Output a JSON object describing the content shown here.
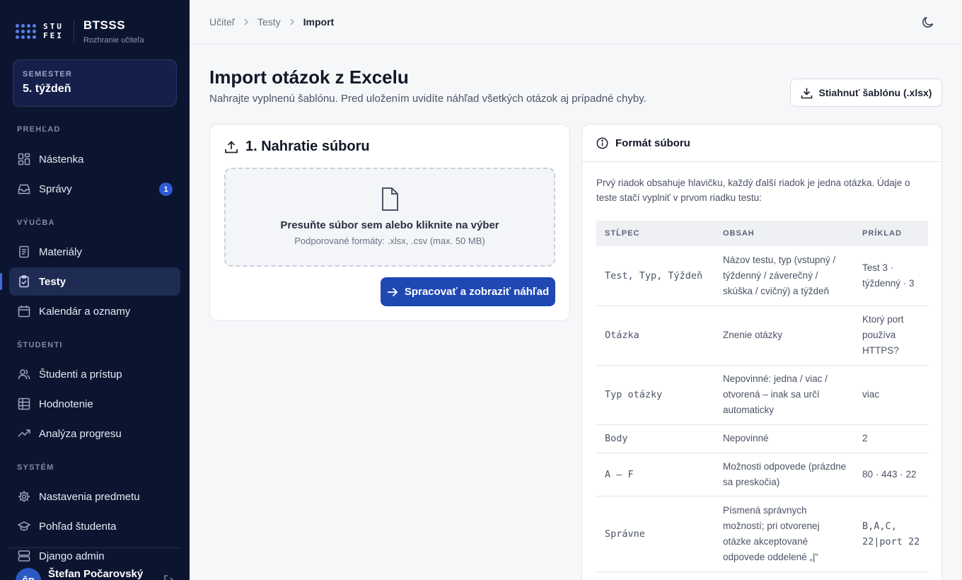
{
  "brand": {
    "logo_text_1": "STU",
    "logo_text_2": "FEI",
    "name": "BTSSS",
    "subtitle": "Rozhranie učiteľa"
  },
  "semester": {
    "label": "SEMESTER",
    "value": "5. týždeň"
  },
  "sidebar": {
    "sections": [
      {
        "label": "PREHĽAD",
        "items": [
          {
            "label": "Nástenka",
            "icon": "dashboard-icon"
          },
          {
            "label": "Správy",
            "icon": "inbox-icon",
            "badge": "1"
          }
        ]
      },
      {
        "label": "VÝUČBA",
        "items": [
          {
            "label": "Materiály",
            "icon": "document-icon"
          },
          {
            "label": "Testy",
            "icon": "clipboard-check-icon",
            "active": true
          },
          {
            "label": "Kalendár a oznamy",
            "icon": "calendar-icon"
          }
        ]
      },
      {
        "label": "ŠTUDENTI",
        "items": [
          {
            "label": "Študenti a prístup",
            "icon": "users-icon"
          },
          {
            "label": "Hodnotenie",
            "icon": "table-icon"
          },
          {
            "label": "Analýza progresu",
            "icon": "trend-icon"
          }
        ]
      },
      {
        "label": "SYSTÉM",
        "items": [
          {
            "label": "Nastavenia predmetu",
            "icon": "gear-icon"
          },
          {
            "label": "Pohľad študenta",
            "icon": "graduation-cap-icon"
          },
          {
            "label": "Django admin",
            "icon": "server-icon"
          }
        ]
      }
    ]
  },
  "user": {
    "initials": "ŠP",
    "name": "Štefan Počarovský"
  },
  "breadcrumb": [
    "Učiteľ",
    "Testy",
    "Import"
  ],
  "page": {
    "title": "Import otázok z Excelu",
    "subtitle": "Nahrajte vyplnenú šablónu. Pred uložením uvidíte náhľad všetkých otázok aj prípadné chyby.",
    "download_label": "Stiahnuť šablónu (.xlsx)"
  },
  "upload": {
    "title": "1. Nahratie súboru",
    "drop_text": "Presuňte súbor sem alebo kliknite na výber",
    "formats": "Podporované formáty: .xlsx, .csv (max. 50 MB)",
    "process_label": "Spracovať a zobraziť náhľad"
  },
  "format": {
    "title": "Formát súboru",
    "intro": "Prvý riadok obsahuje hlavičku, každý ďalší riadok je jedna otázka. Údaje o teste stačí vyplniť v prvom riadku testu:",
    "headers": [
      "STĹPEC",
      "OBSAH",
      "PRÍKLAD"
    ],
    "rows": [
      {
        "col": "Test, Typ, Týždeň",
        "content": "Názov testu, typ (vstupný / týždenný / záverečný / skúška / cvičný) a týždeň",
        "example": "Test 3 · týždenný · 3"
      },
      {
        "col": "Otázka",
        "content": "Znenie otázky",
        "example": "Ktorý port používa HTTPS?"
      },
      {
        "col": "Typ otázky",
        "content": "Nepovinné: jedna / viac / otvorená – inak sa určí automaticky",
        "example": "viac"
      },
      {
        "col": "Body",
        "content": "Nepovinné",
        "example": "2"
      },
      {
        "col": "A – F",
        "content": "Možnosti odpovede (prázdne sa preskočia)",
        "example": "80 · 443 · 22"
      },
      {
        "col": "Správne",
        "content": "Písmená správnych možností; pri otvorenej otázke akceptované odpovede oddelené „|“",
        "example": "B,A,C, 22|port 22"
      }
    ]
  }
}
